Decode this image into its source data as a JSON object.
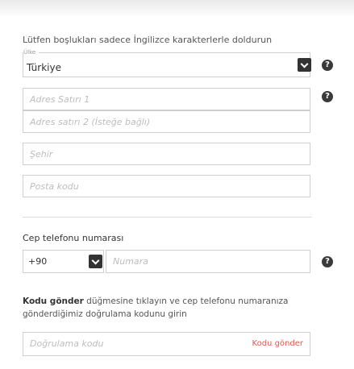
{
  "note": "Lütfen boşlukları sadece İngilizce karakterlerle doldurun",
  "country": {
    "label": "Ülke",
    "value": "Türkiye"
  },
  "address": {
    "line1_placeholder": "Adres Satırı 1",
    "line2_placeholder": "Adres satırı 2 (İsteğe bağlı)"
  },
  "city_placeholder": "Şehir",
  "postal_placeholder": "Posta kodu",
  "phone": {
    "title": "Cep telefonu numarası",
    "code": "+90",
    "number_placeholder": "Numara"
  },
  "verify": {
    "instr_bold": "Kodu gönder",
    "instr_rest": " düğmesine tıklayın ve cep telefonu numaranıza gönderdiğimiz doğrulama kodunu girin",
    "code_placeholder": "Doğrulama kodu",
    "send_label": "Kodu gönder"
  },
  "help_glyph": "?"
}
